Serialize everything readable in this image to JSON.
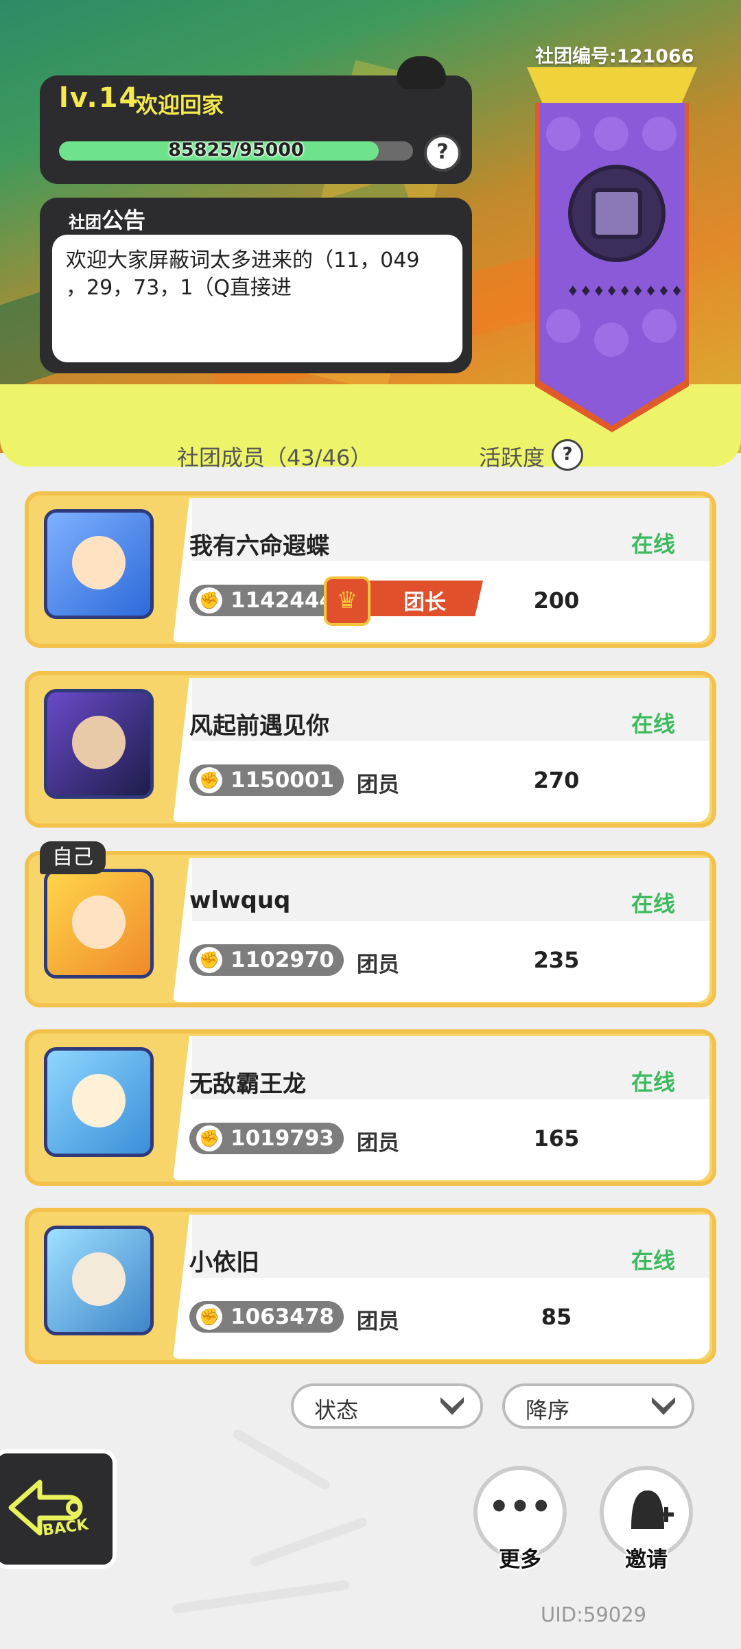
{
  "header": {
    "level": "lv.14",
    "welcome": "欢迎回家",
    "exp_text": "85825/95000",
    "exp_progress": 0.903,
    "notice_title_small": "社团",
    "notice_title_big": "公告",
    "notice_text": "欢迎大家屏蔽词太多进来的（11，049\n，29，73，1（Q直接进",
    "club_id": "社团编号:121066",
    "banner_stars": "♦♦♦♦♦♦♦♦♦♦"
  },
  "list": {
    "members_label": "社团成员（43/46）",
    "activity_label": "活跃度",
    "help_icon": "?"
  },
  "members": [
    {
      "name": "我有六命遐蝶",
      "status": "在线",
      "power": "1142444",
      "role": "团长",
      "activity": "200",
      "is_leader": true
    },
    {
      "name": "风起前遇见你",
      "status": "在线",
      "power": "1150001",
      "role": "团员",
      "activity": "270"
    },
    {
      "name": "wlwquq",
      "status": "在线",
      "power": "1102970",
      "role": "团员",
      "activity": "235",
      "self_tag": "自己"
    },
    {
      "name": "无敌霸王龙",
      "status": "在线",
      "power": "1019793",
      "role": "团员",
      "activity": "165"
    },
    {
      "name": "小依旧",
      "status": "在线",
      "power": "1063478",
      "role": "团员",
      "activity": "85"
    }
  ],
  "filters": {
    "status_label": "状态",
    "order_label": "降序"
  },
  "bottom": {
    "back_label": "BACK",
    "more_label": "更多",
    "invite_label": "邀请",
    "uid": "UID:59029"
  },
  "colors": {
    "online": "#3dba5e",
    "exp_fill": "#6fe38c",
    "leader_badge": "#e0502d",
    "card_gold": "#f8d56a",
    "banner_purple": "#8a5ad8",
    "dark_panel": "#2c2c2e"
  },
  "icons": [
    "question-icon",
    "fist-icon",
    "crown-icon",
    "chevron-down-icon",
    "back-arrow-icon",
    "more-dots-icon",
    "invite-person-icon"
  ]
}
